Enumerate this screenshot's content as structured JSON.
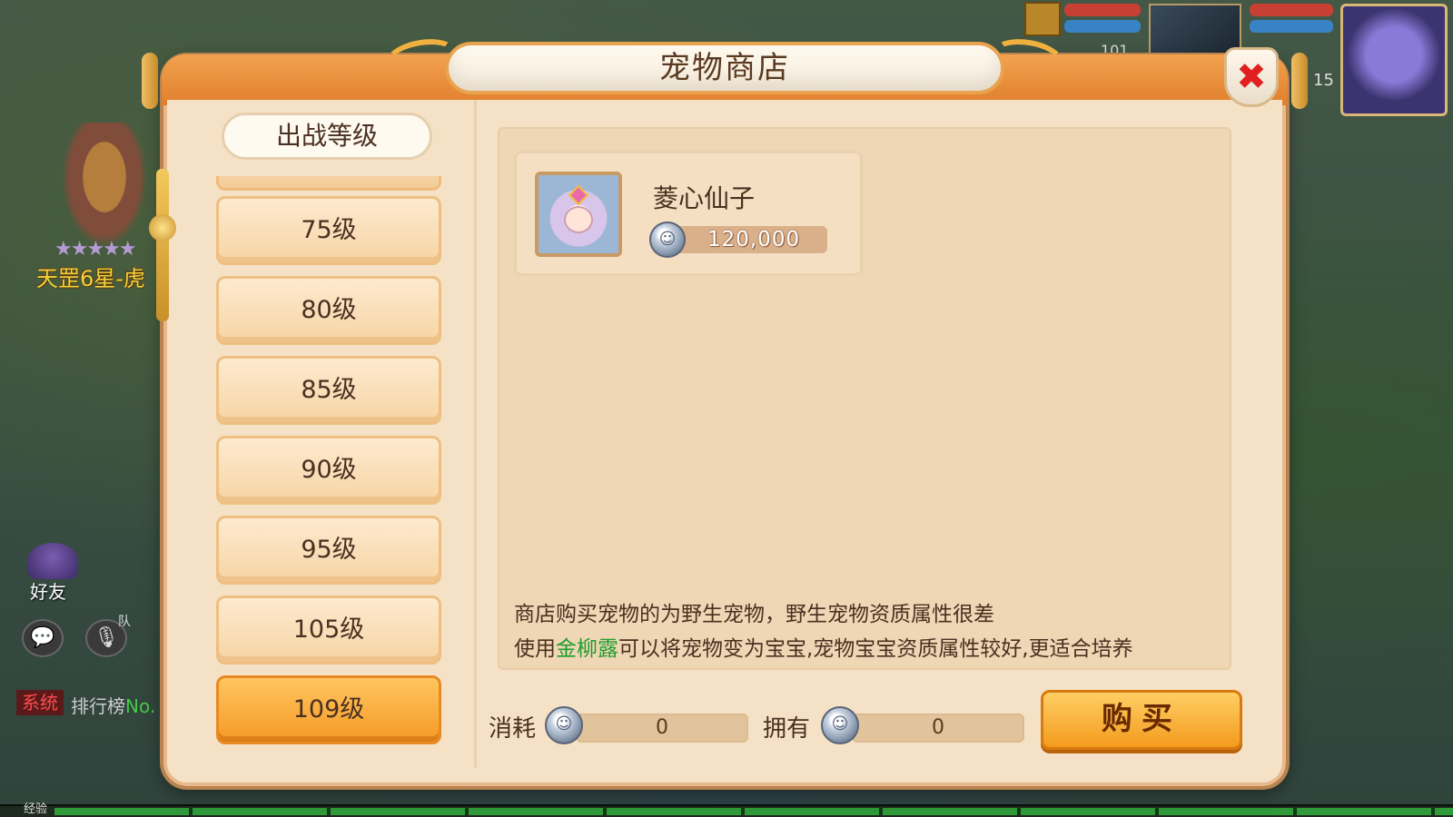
{
  "hud": {
    "pet_name": "天罡6星-虎",
    "stars": "★★★★★",
    "friends_label": "好友",
    "chat_icon": "💬",
    "mic_icon": "🎙",
    "team_label": "队",
    "system_badge": "系统",
    "rank_label": "排行榜",
    "rank_suffix": "No.",
    "exp_label": "经验",
    "level_a": "101",
    "level_b": "15"
  },
  "modal": {
    "title": "宠物商店",
    "close_icon": "✖"
  },
  "left": {
    "section_title": "出战等级",
    "levels": [
      {
        "label": "75级",
        "active": false
      },
      {
        "label": "80级",
        "active": false
      },
      {
        "label": "85级",
        "active": false
      },
      {
        "label": "90级",
        "active": false
      },
      {
        "label": "95级",
        "active": false
      },
      {
        "label": "105级",
        "active": false
      },
      {
        "label": "109级",
        "active": true
      }
    ]
  },
  "item": {
    "name": "菱心仙子",
    "price": "120,000",
    "coin_icon": "silver-coin-icon"
  },
  "notice": {
    "line1": "商店购买宠物的为野生宠物，野生宠物资质属性很差",
    "line2_prefix": "使用",
    "line2_highlight": "金柳露",
    "line2_suffix": "可以将宠物变为宝宝,宠物宝宝资质属性较好,更适合培养"
  },
  "footer": {
    "cost_label": "消耗",
    "cost_value": "0",
    "own_label": "拥有",
    "own_value": "0",
    "buy_label": "购买"
  },
  "colors": {
    "accent_orange": "#f39b1e",
    "highlight_green": "#1e9e2e",
    "close_red": "#e02020"
  }
}
